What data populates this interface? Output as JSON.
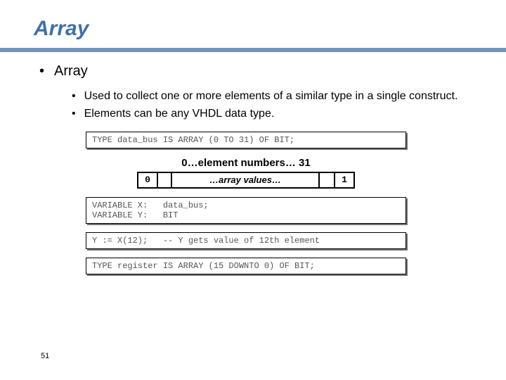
{
  "title": "Array",
  "bullets": {
    "l1": "Array",
    "l2a": "Used to collect one or more elements of a similar type in a single construct.",
    "l2b": "Elements can be any VHDL data type."
  },
  "code": {
    "box1": "TYPE data_bus IS ARRAY (0 TO 31) OF BIT;",
    "box2": "VARIABLE X:   data_bus;\nVARIABLE Y:   BIT",
    "box3": "Y := X(12);   -- Y gets value of 12th element",
    "box4": "TYPE register IS ARRAY (15 DOWNTO 0) OF BIT;"
  },
  "diagram": {
    "top": "0…element  numbers… 31",
    "left": "0",
    "mid": "…array values…",
    "right": "1"
  },
  "page": "51"
}
